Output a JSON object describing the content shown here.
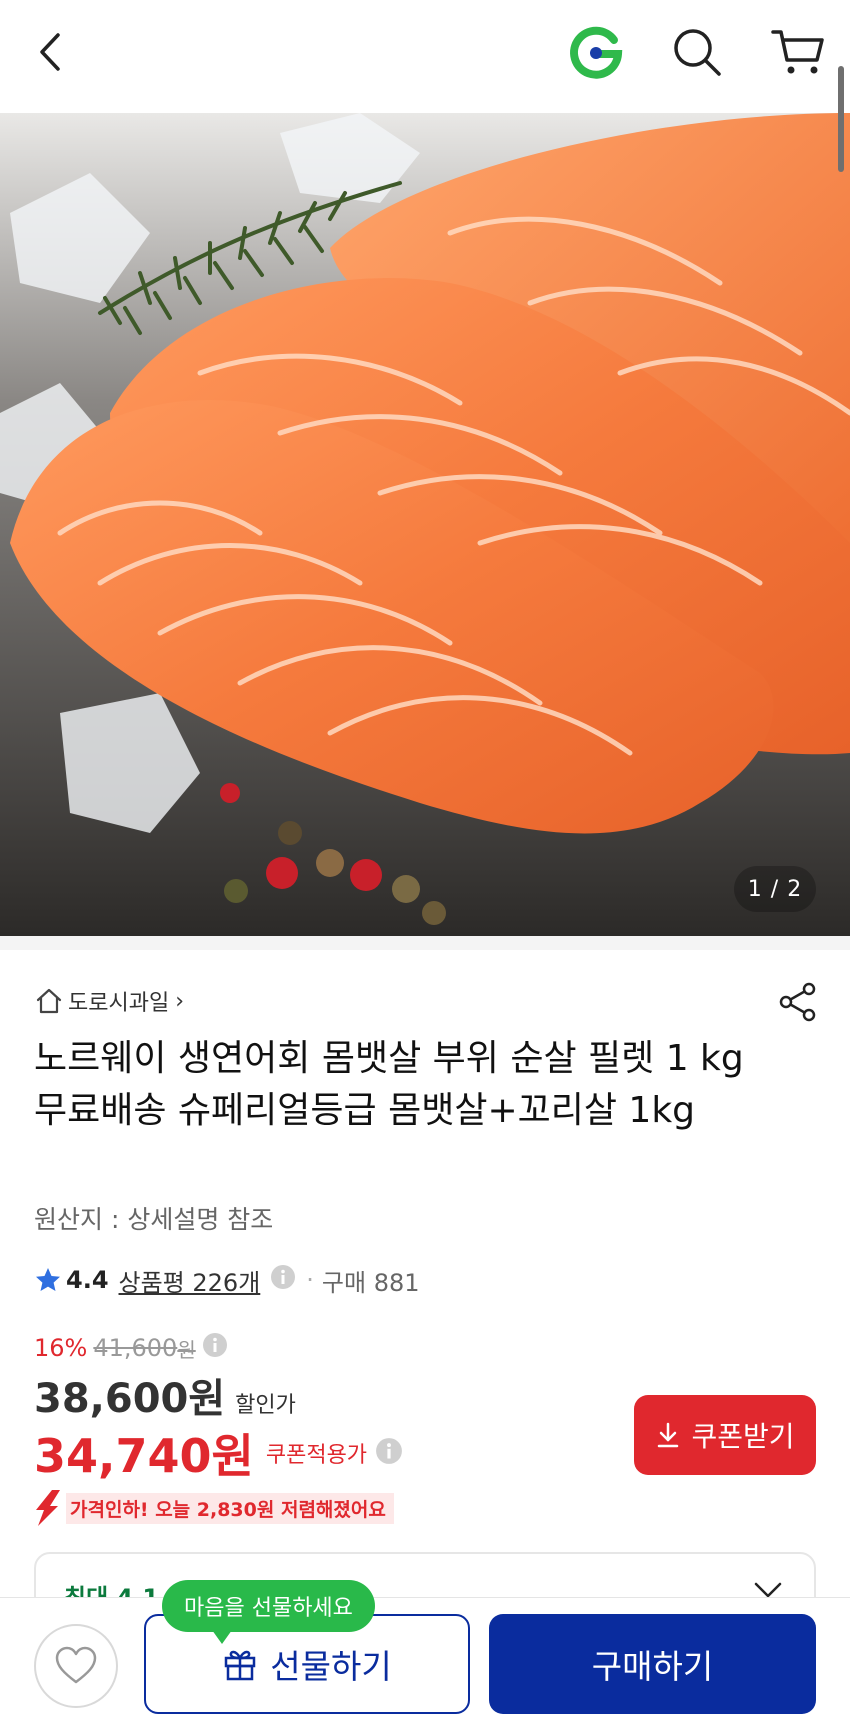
{
  "header": {
    "back_icon": "chevron-left-icon",
    "brand_icon": "gmarket-g-logo",
    "search_icon": "search-icon",
    "cart_icon": "cart-icon"
  },
  "gallery": {
    "counter": "1 / 2"
  },
  "product": {
    "seller": "도로시과일",
    "seller_chevron": "›",
    "title": "노르웨이 생연어회 몸뱃살 부위 순살 필렛 1 kg 무료배송 슈페리얼등급 몸뱃살+꼬리살 1kg",
    "origin": "원산지 : 상세설명 참조"
  },
  "rating": {
    "score": "4.4",
    "reviews": "상품평 226개",
    "sep": "·",
    "purchases": "구매 881"
  },
  "price": {
    "discount_pct": "16%",
    "original": "41,600",
    "original_unit": "원",
    "sale": "38,600원",
    "sale_label": "할인가",
    "coupon_price": "34,740원",
    "coupon_label": "쿠폰적용가",
    "coupon_button": "쿠폰받기",
    "drop_notice": "가격인하! 오늘 2,830원 저렴해졌어요"
  },
  "benefit": {
    "text": "최대 4,1"
  },
  "bottom": {
    "gift_tooltip": "마음을 선물하세요",
    "gift_button": "선물하기",
    "buy_button": "구매하기"
  },
  "colors": {
    "accent_red": "#e0282e",
    "navy": "#0a2c9e",
    "green": "#29b94a"
  }
}
